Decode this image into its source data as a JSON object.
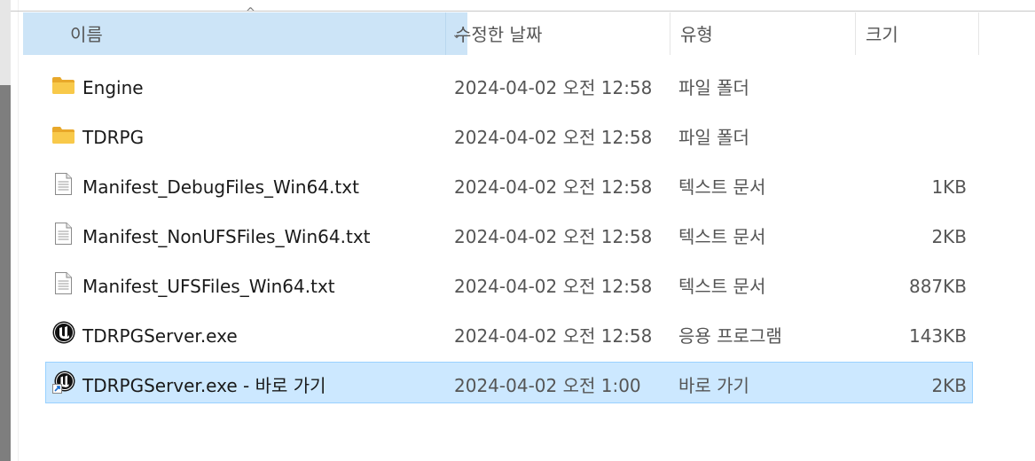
{
  "header": {
    "columns": {
      "name": "이름",
      "date": "수정한 날짜",
      "type": "유형",
      "size": "크기"
    },
    "sort_indicator": "^",
    "dropdown_indicator": "⌄"
  },
  "files": [
    {
      "icon": "folder-icon",
      "name": "Engine",
      "date": "2024-04-02 오전 12:58",
      "type": "파일 폴더",
      "size": ""
    },
    {
      "icon": "folder-icon",
      "name": "TDRPG",
      "date": "2024-04-02 오전 12:58",
      "type": "파일 폴더",
      "size": ""
    },
    {
      "icon": "text-file-icon",
      "name": "Manifest_DebugFiles_Win64.txt",
      "date": "2024-04-02 오전 12:58",
      "type": "텍스트 문서",
      "size": "1KB"
    },
    {
      "icon": "text-file-icon",
      "name": "Manifest_NonUFSFiles_Win64.txt",
      "date": "2024-04-02 오전 12:58",
      "type": "텍스트 문서",
      "size": "2KB"
    },
    {
      "icon": "text-file-icon",
      "name": "Manifest_UFSFiles_Win64.txt",
      "date": "2024-04-02 오전 12:58",
      "type": "텍스트 문서",
      "size": "887KB"
    },
    {
      "icon": "unreal-engine-icon",
      "name": "TDRPGServer.exe",
      "date": "2024-04-02 오전 12:58",
      "type": "응용 프로그램",
      "size": "143KB"
    },
    {
      "icon": "unreal-engine-shortcut-icon",
      "name": "TDRPGServer.exe - 바로 가기",
      "date": "2024-04-02 오전 1:00",
      "type": "바로 가기",
      "size": "2KB",
      "selected": true
    }
  ],
  "colors": {
    "selection_bg": "#cce8ff",
    "selection_border": "#99d1ff",
    "header_sorted_bg": "#cce4f7",
    "folder_yellow": "#f8c94a"
  }
}
